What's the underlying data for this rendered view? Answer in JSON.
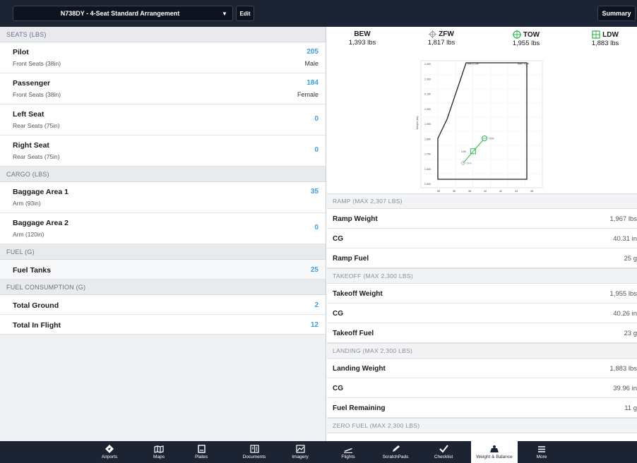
{
  "header": {
    "profile": "N738DY - 4-Seat Standard Arrangement",
    "edit_label": "Edit",
    "summary_label": "Summary"
  },
  "left": {
    "seats_header": "SEATS (LBS)",
    "seats": [
      {
        "name": "Pilot",
        "sub": "Front Seats (38in)",
        "value": "205",
        "extra": "Male"
      },
      {
        "name": "Passenger",
        "sub": "Front Seats (38in)",
        "value": "184",
        "extra": "Female"
      },
      {
        "name": "Left Seat",
        "sub": "Rear Seats (75in)",
        "value": "0"
      },
      {
        "name": "Right Seat",
        "sub": "Rear Seats (75in)",
        "value": "0"
      }
    ],
    "cargo_header": "CARGO (LBS)",
    "cargo": [
      {
        "name": "Baggage Area 1",
        "sub": "Arm (93in)",
        "value": "35"
      },
      {
        "name": "Baggage Area 2",
        "sub": "Arm (120in)",
        "value": "0"
      }
    ],
    "fuel_header": "FUEL (G)",
    "fuel": {
      "name": "Fuel Tanks",
      "value": "25"
    },
    "consumption_header": "FUEL CONSUMPTION (G)",
    "consumption": [
      {
        "name": "Total Ground",
        "value": "2"
      },
      {
        "name": "Total In Flight",
        "value": "12"
      }
    ]
  },
  "stats": [
    {
      "label": "BEW",
      "value": "1,393 lbs",
      "icon": "none"
    },
    {
      "label": "ZFW",
      "value": "1,817 lbs",
      "icon": "diamond-crosshair-icon"
    },
    {
      "label": "TOW",
      "value": "1,955 lbs",
      "icon": "circle-crosshair-icon"
    },
    {
      "label": "LDW",
      "value": "1,883 lbs",
      "icon": "square-crosshair-icon"
    }
  ],
  "chart_data": {
    "type": "scatter",
    "ylabel": "Weight (lbs)",
    "y_ticks": [
      "2,400",
      "2,300",
      "2,100",
      "2,000",
      "1,900",
      "1,800",
      "1,700",
      "1,600",
      "1,500"
    ],
    "x_ticks": [
      "35",
      "36",
      "38",
      "40",
      "42",
      "44",
      "46"
    ],
    "envelope_labels": [
      "MAX LDW",
      "MAX TOW"
    ],
    "points": [
      {
        "name": "TOW",
        "x": 40.26,
        "y": 1955
      },
      {
        "name": "LDW",
        "x": 39.96,
        "y": 1883
      },
      {
        "name": "ZFW",
        "x": 39.7,
        "y": 1817
      }
    ]
  },
  "sections": [
    {
      "header": "RAMP (MAX 2,307 LBS)",
      "rows": [
        {
          "name": "Ramp Weight",
          "value": "1,967 lbs"
        },
        {
          "name": "CG",
          "value": "40.31 in"
        },
        {
          "name": "Ramp Fuel",
          "value": "25 g"
        }
      ]
    },
    {
      "header": "TAKEOFF (MAX 2,300 LBS)",
      "rows": [
        {
          "name": "Takeoff Weight",
          "value": "1,955 lbs"
        },
        {
          "name": "CG",
          "value": "40.26 in"
        },
        {
          "name": "Takeoff Fuel",
          "value": "23 g"
        }
      ]
    },
    {
      "header": "LANDING (MAX 2,300 LBS)",
      "rows": [
        {
          "name": "Landing Weight",
          "value": "1,883 lbs"
        },
        {
          "name": "CG",
          "value": "39.96 in"
        },
        {
          "name": "Fuel Remaining",
          "value": "11 g"
        }
      ]
    },
    {
      "header": "ZERO FUEL (MAX 2,300 LBS)",
      "rows": []
    }
  ],
  "tabs": [
    {
      "label": "Airports",
      "icon": "airports-icon"
    },
    {
      "label": "Maps",
      "icon": "maps-icon"
    },
    {
      "label": "Plates",
      "icon": "plates-icon"
    },
    {
      "label": "Documents",
      "icon": "documents-icon"
    },
    {
      "label": "Imagery",
      "icon": "imagery-icon"
    },
    {
      "label": "Flights",
      "icon": "flights-icon"
    },
    {
      "label": "ScratchPads",
      "icon": "scratchpads-icon"
    },
    {
      "label": "Checklist",
      "icon": "checklist-icon"
    },
    {
      "label": "Weight & Balance",
      "icon": "weight-balance-icon",
      "active": true
    },
    {
      "label": "More",
      "icon": "more-icon"
    }
  ],
  "colors": {
    "accent": "#3ba0e6",
    "bar": "#1c2433",
    "tow": "#2db84d"
  }
}
